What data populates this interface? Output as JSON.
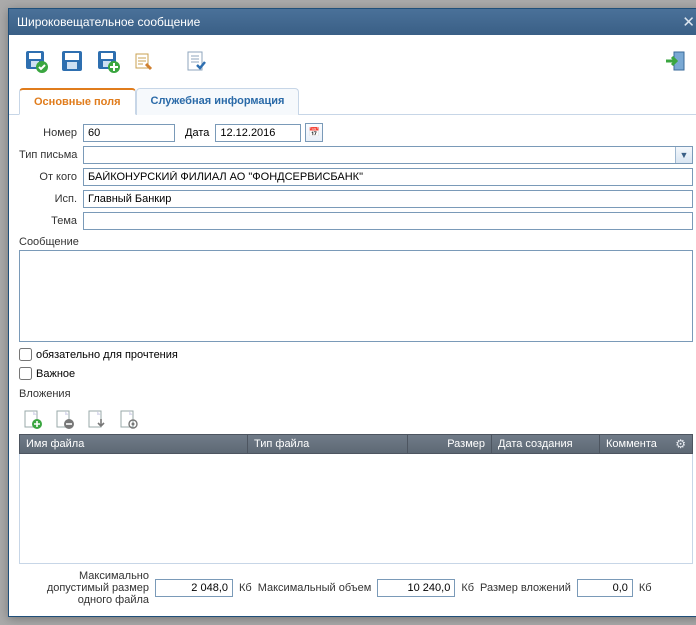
{
  "window": {
    "title": "Широковещательное сообщение"
  },
  "tabs": {
    "main": "Основные поля",
    "service": "Служебная информация"
  },
  "labels": {
    "number": "Номер",
    "date": "Дата",
    "type": "Тип письма",
    "from": "От кого",
    "exec": "Исп.",
    "subject": "Тема",
    "message": "Сообщение",
    "attachments": "Вложения"
  },
  "values": {
    "number": "60",
    "date": "12.12.2016",
    "type": "",
    "from": "БАЙКОНУРСКИЙ ФИЛИАЛ АО \"ФОНДСЕРВИСБАНК\"",
    "exec": "Главный Банкир",
    "subject": "",
    "message": ""
  },
  "checkboxes": {
    "mandatory": "обязательно для прочтения",
    "important": "Важное"
  },
  "grid": {
    "col_file": "Имя файла",
    "col_type": "Тип файла",
    "col_size": "Размер",
    "col_date": "Дата создания",
    "col_comment": "Коммента"
  },
  "footer": {
    "max_one_label": "Максимально допустимый размер одного файла",
    "max_one_value": "2 048,0",
    "max_vol_label": "Максимальный объем",
    "max_vol_value": "10 240,0",
    "att_size_label": "Размер вложений",
    "att_size_value": "0,0",
    "unit": "Кб"
  }
}
